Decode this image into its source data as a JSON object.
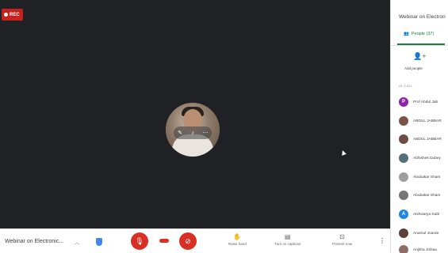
{
  "stage": {
    "rec_label": "REC"
  },
  "sidebar": {
    "title": "Webinar on Electron",
    "tab_label": "People (37)",
    "add_people_label": "Add people",
    "in_call_label": "IN CALL",
    "people": [
      {
        "name": "Prof Abdul Jab",
        "initial": "P",
        "color": "#8e24aa"
      },
      {
        "name": "ABDUL JABBAR",
        "initial": "",
        "color": "#795548"
      },
      {
        "name": "ABDUL JABBAR",
        "initial": "",
        "color": "#6d4c41"
      },
      {
        "name": "Abhishek Dubey",
        "initial": "",
        "color": "#546e7a"
      },
      {
        "name": "Abubakar Sham",
        "initial": "",
        "color": "#9e9e9e"
      },
      {
        "name": "Abubakar Sham",
        "initial": "",
        "color": "#757575"
      },
      {
        "name": "Aishwarya Kabl",
        "initial": "A",
        "color": "#1e88e5"
      },
      {
        "name": "Anamul Joarde",
        "initial": "",
        "color": "#5d4037"
      },
      {
        "name": "Anjitha Jishaa",
        "initial": "",
        "color": "#8d6e63"
      }
    ]
  },
  "bottom_bar": {
    "meeting_title": "Webinar on Electronic...",
    "raise_hand_label": "Raise hand",
    "captions_label": "Turn on captions",
    "present_label": "Present now"
  }
}
